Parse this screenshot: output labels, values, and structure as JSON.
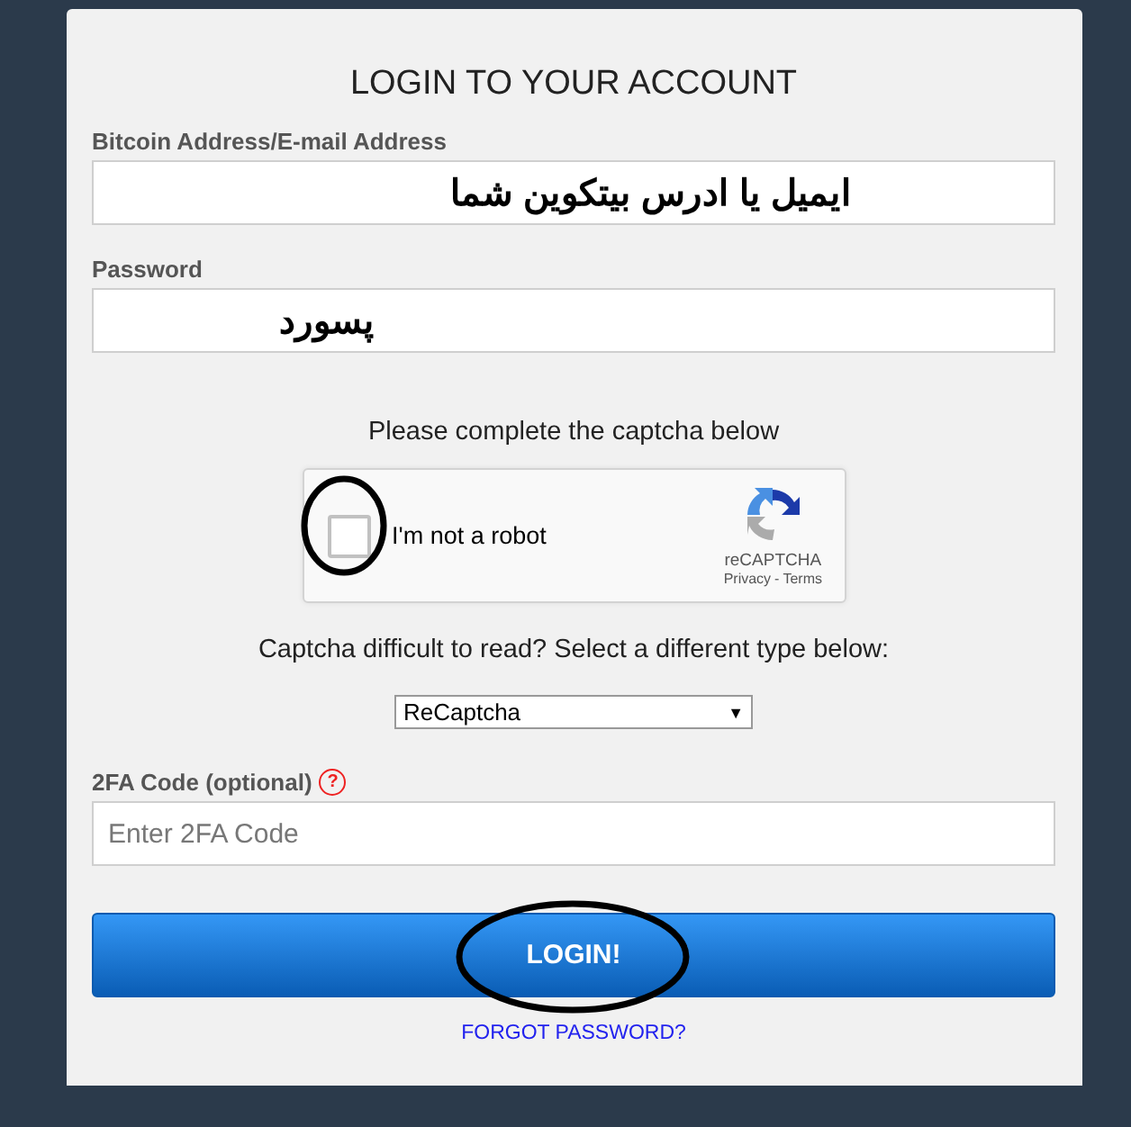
{
  "title": "LOGIN TO YOUR ACCOUNT",
  "fields": [
    {
      "label": "Bitcoin Address/E-mail Address",
      "value": "ایمیل یا ادرس بیتکوین شما"
    },
    {
      "label": "Password",
      "value": "پسورد"
    }
  ],
  "captcha_prompt": "Please complete the captcha below",
  "recaptcha": {
    "label": "I'm not a robot",
    "checked": false,
    "brand": "reCAPTCHA",
    "privacy": "Privacy",
    "separator": "-",
    "terms": "Terms"
  },
  "captcha_type": {
    "prompt": "Captcha difficult to read? Select a different type below:",
    "value": "ReCaptcha",
    "arrow": "▼"
  },
  "twofa": {
    "label": "2FA Code (optional)",
    "help": "?",
    "placeholder": "Enter 2FA Code"
  },
  "login_button": "LOGIN!",
  "forgot_link": "FORGOT PASSWORD?"
}
